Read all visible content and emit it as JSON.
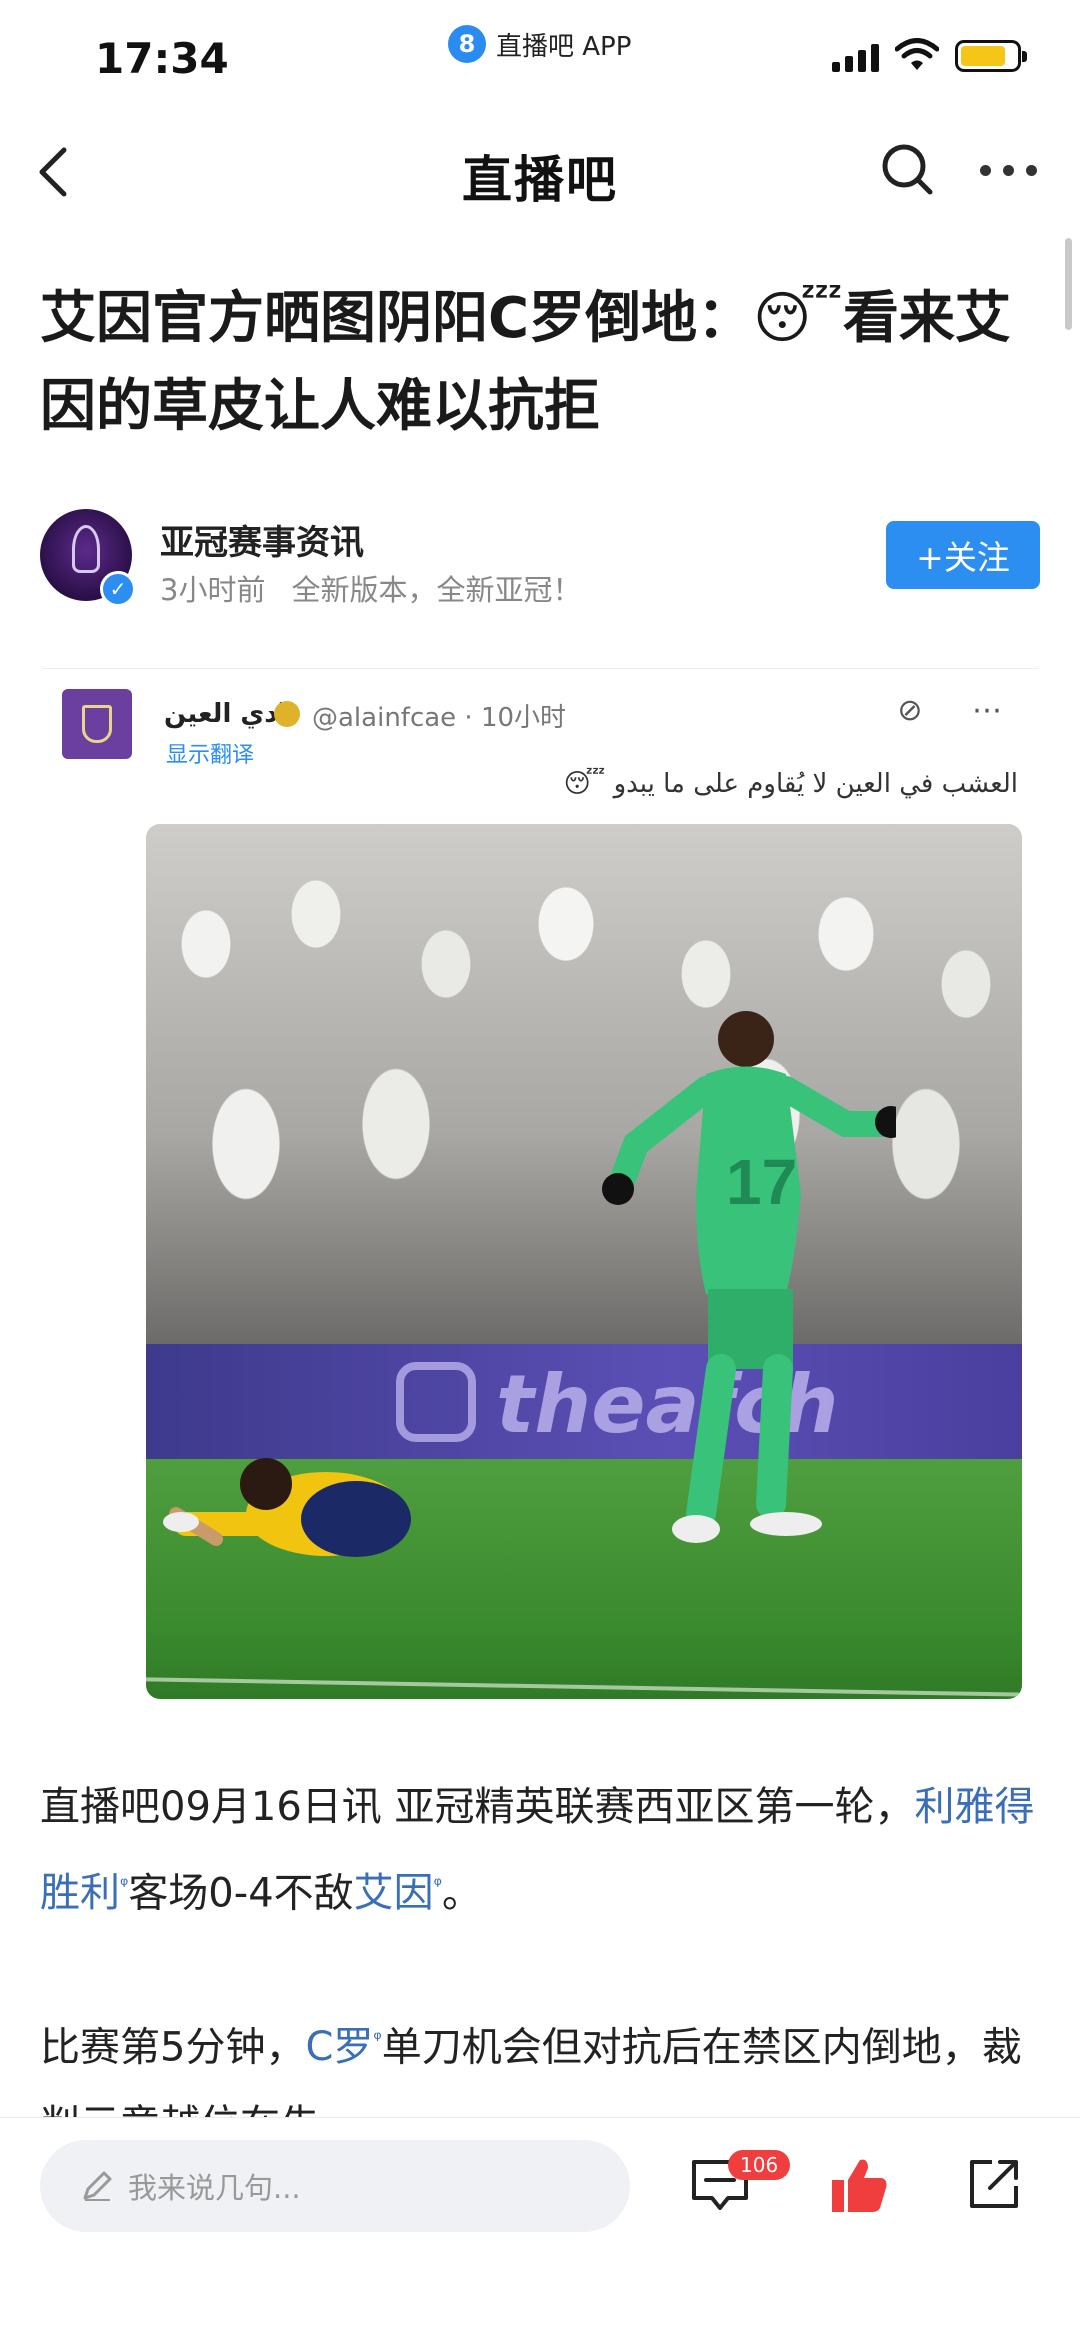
{
  "status_bar": {
    "time": "17:34",
    "app_badge": "直播吧 APP",
    "app_badge_logo": "8",
    "colors": {
      "battery": "#f5c518"
    }
  },
  "nav": {
    "title": "直播吧",
    "icons": [
      "back-icon",
      "search-icon",
      "more-icon"
    ]
  },
  "article": {
    "title": "艾因官方晒图阴阳C罗倒地：😴看来艾因的草皮让人难以抗拒",
    "author": {
      "name": "亚冠赛事资讯",
      "time": "3小时前",
      "tagline": "全新版本，全新亚冠！",
      "follow_label": "+关注",
      "verify_mark": "✓"
    },
    "embed": {
      "account_name": "نادي العين",
      "handle": "@alainfcae · 10小时",
      "translate_label": "显示翻译",
      "tweet_text": "العشب في العين لا يُقاوم على ما يبدو 😴",
      "board_text": "theafch"
    },
    "paragraph1": {
      "prefix": "直播吧09月16日讯  亚冠精英联赛西亚区第一轮，",
      "link1": "利雅得胜利",
      "middle": "客场0-4不敌",
      "link2": "艾因",
      "suffix": "。"
    },
    "paragraph2": {
      "prefix": "比赛第5分钟，",
      "link": "C罗",
      "suffix": "单刀机会但对抗后在禁区内倒地，裁判示意越位在先。"
    },
    "link_marker": "ᵠ"
  },
  "bottom_bar": {
    "comment_placeholder": "我来说几句...",
    "comment_count": "106",
    "colors": {
      "like": "#f03d3d",
      "follow": "#2b8ef0",
      "link": "#3a6fb8"
    }
  }
}
